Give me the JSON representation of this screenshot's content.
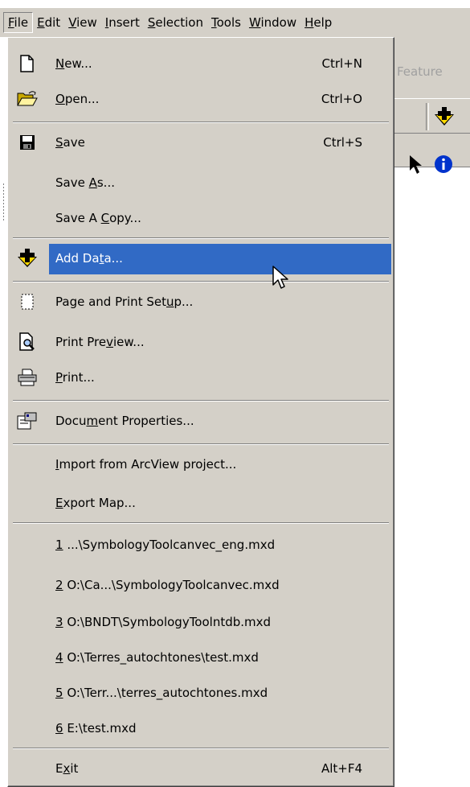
{
  "menubar": {
    "items": [
      {
        "label": "File",
        "key": "F",
        "rest": "ile"
      },
      {
        "label": "Edit",
        "key": "E",
        "rest": "dit"
      },
      {
        "label": "View",
        "key": "V",
        "rest": "iew"
      },
      {
        "label": "Insert",
        "key": "I",
        "rest": "nsert"
      },
      {
        "label": "Selection",
        "key": "S",
        "rest": "election"
      },
      {
        "label": "Tools",
        "key": "T",
        "rest": "ools"
      },
      {
        "label": "Window",
        "key": "W",
        "rest": "indow"
      },
      {
        "label": "Help",
        "key": "H",
        "rest": "elp"
      }
    ]
  },
  "toolbar": {
    "feature_text": "Feature"
  },
  "menu": {
    "new": {
      "pre": "",
      "key": "N",
      "post": "ew...",
      "shortcut": "Ctrl+N"
    },
    "open": {
      "pre": "",
      "key": "O",
      "post": "pen...",
      "shortcut": "Ctrl+O"
    },
    "save": {
      "pre": "",
      "key": "S",
      "post": "ave",
      "shortcut": "Ctrl+S"
    },
    "save_as": {
      "pre": "Save ",
      "key": "A",
      "post": "s..."
    },
    "save_copy": {
      "pre": "Save A ",
      "key": "C",
      "post": "opy..."
    },
    "add_data": {
      "pre": "Add Da",
      "key": "t",
      "post": "a..."
    },
    "page_setup": {
      "pre": "Page and Print Set",
      "key": "u",
      "post": "p..."
    },
    "print_preview": {
      "pre": "Print Pre",
      "key": "v",
      "post": "iew..."
    },
    "print": {
      "pre": "",
      "key": "P",
      "post": "rint..."
    },
    "doc_props": {
      "pre": "Docu",
      "key": "m",
      "post": "ent Properties..."
    },
    "import": {
      "pre": "",
      "key": "I",
      "post": "mport from ArcView project..."
    },
    "export": {
      "pre": "",
      "key": "E",
      "post": "xport Map..."
    },
    "recent": [
      {
        "key": "1",
        "post": " ...\\SymbologyToolcanvec_eng.mxd"
      },
      {
        "key": "2",
        "post": " O:\\Ca...\\SymbologyToolcanvec.mxd"
      },
      {
        "key": "3",
        "post": " O:\\BNDT\\SymbologyToolntdb.mxd"
      },
      {
        "key": "4",
        "post": " O:\\Terres_autochtones\\test.mxd"
      },
      {
        "key": "5",
        "post": " O:\\Terr...\\terres_autochtones.mxd"
      },
      {
        "key": "6",
        "post": " E:\\test.mxd"
      }
    ],
    "exit": {
      "pre": "E",
      "key": "x",
      "post": "it",
      "shortcut": "Alt+F4"
    }
  }
}
